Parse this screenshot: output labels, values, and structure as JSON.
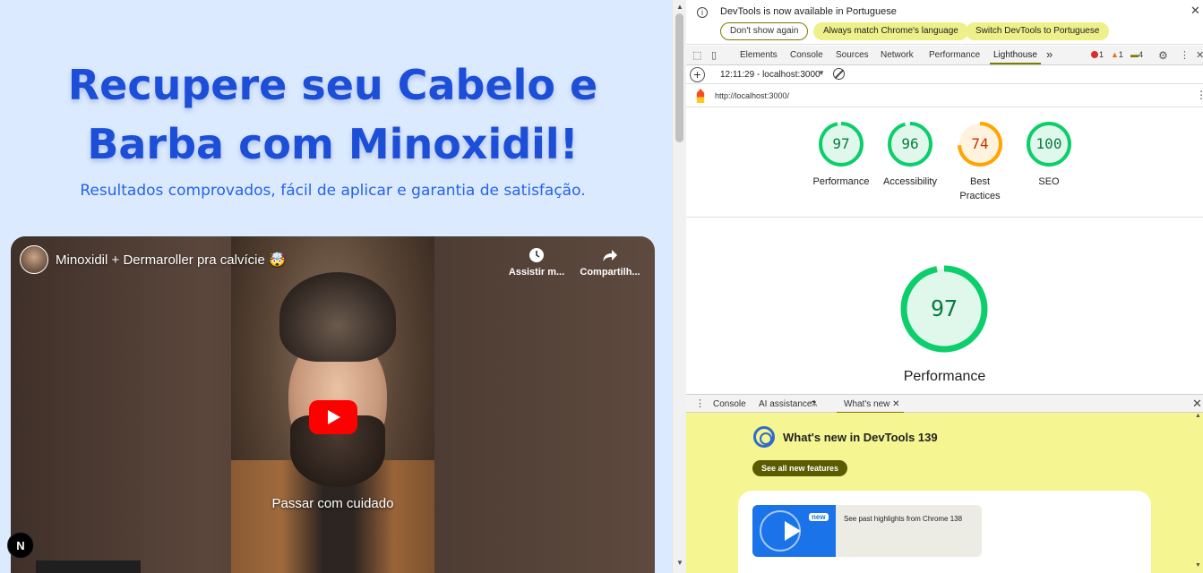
{
  "page": {
    "hero_title": "Recupere seu Cabelo e Barba com Minoxidil!",
    "hero_subtitle": "Resultados comprovados, fácil de aplicar e garantia de satisfação.",
    "video": {
      "title": "Minoxidil + Dermaroller pra calvície 🤯",
      "watch_later": "Assistir m...",
      "share": "Compartilh...",
      "caption": "Passar com cuidado"
    },
    "next_badge": "N"
  },
  "devtools": {
    "infobar": {
      "message": "DevTools is now available in Portuguese",
      "btn_dont_show": "Don't show again",
      "btn_match": "Always match Chrome's language",
      "btn_switch": "Switch DevTools to Portuguese"
    },
    "tabs": [
      "Elements",
      "Console",
      "Sources",
      "Network",
      "Performance",
      "Lighthouse"
    ],
    "more_tabs": "»",
    "issues": {
      "errors": "1",
      "warnings": "1",
      "messages": "4"
    },
    "lighthouse": {
      "report_time": "12:11:29 - localhost:3000",
      "url": "http://localhost:3000/",
      "scores": [
        {
          "label": "Performance",
          "value": "97",
          "color": "#0cce6b"
        },
        {
          "label": "Accessibility",
          "value": "96",
          "color": "#0cce6b"
        },
        {
          "label": "Best Practices",
          "value": "74",
          "color": "#ffa400"
        },
        {
          "label": "SEO",
          "value": "100",
          "color": "#0cce6b"
        }
      ],
      "main_score": "97",
      "main_label": "Performance"
    },
    "drawer": {
      "tabs": [
        "Console",
        "AI assistance",
        "What's new"
      ],
      "whats_new_title": "What's new in DevTools 139",
      "see_all": "See all new features",
      "highlight_text": "See past highlights from Chrome 138",
      "new_badge": "new"
    }
  }
}
